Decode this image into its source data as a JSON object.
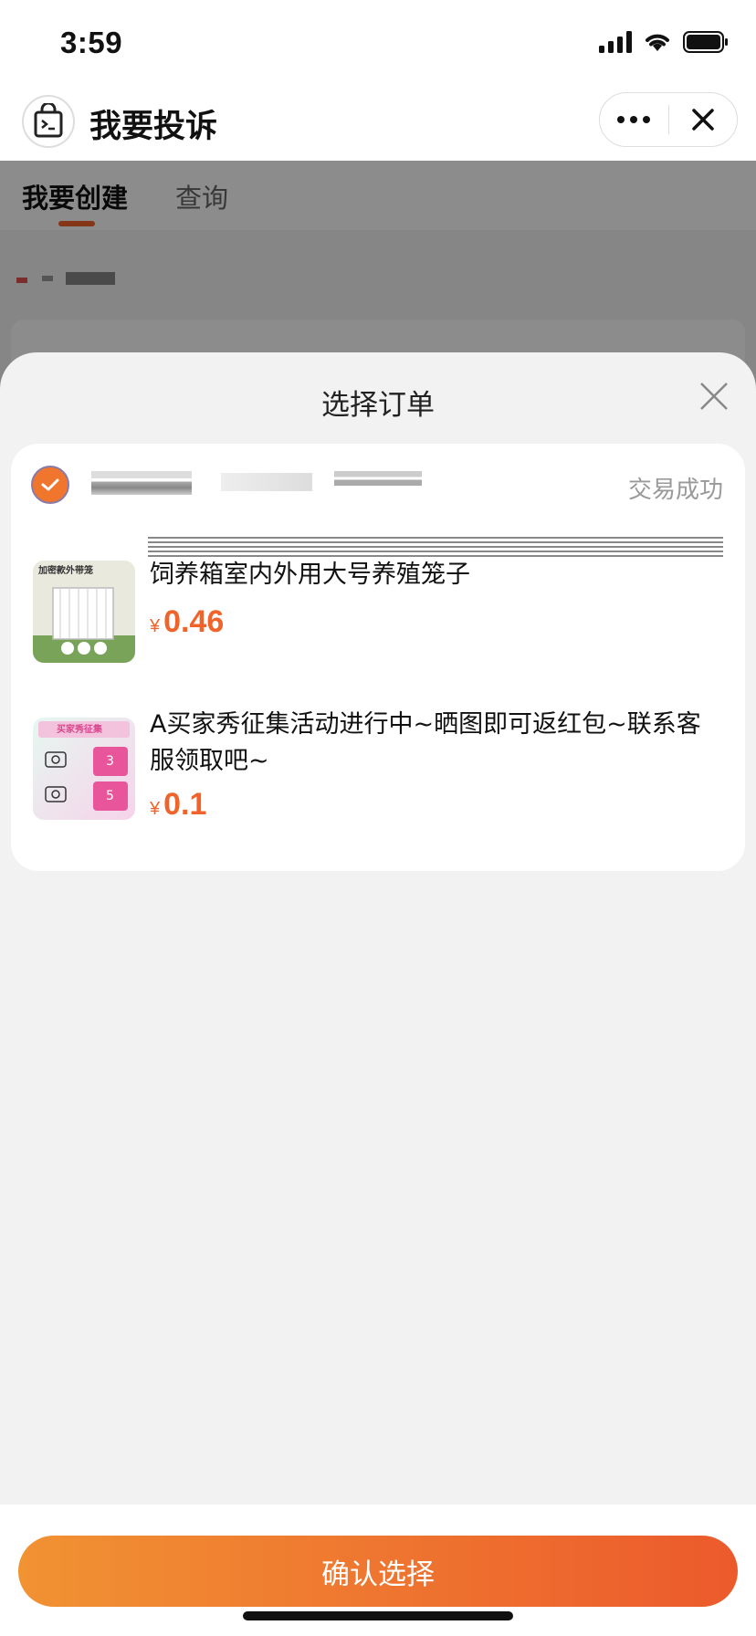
{
  "status_bar": {
    "time": "3:59",
    "icons": [
      "cellular-signal-icon",
      "wifi-icon",
      "battery-icon"
    ]
  },
  "nav": {
    "title": "我要投诉",
    "icons": [
      "app-bag-icon",
      "more-dots-icon",
      "close-icon"
    ]
  },
  "tabs": [
    {
      "label": "我要创建",
      "active": true
    },
    {
      "label": "查询",
      "active": false
    }
  ],
  "sheet": {
    "title": "选择订单",
    "close_icon": "close-icon",
    "order": {
      "selected": true,
      "status": "交易成功",
      "items": [
        {
          "title": "饲养箱室内外用大号养殖笼子",
          "currency": "¥",
          "price": "0.46",
          "thumb_text": "加密款外带笼"
        },
        {
          "title": "A买家秀征集活动进行中~晒图即可返红包~联系客服领取吧~",
          "currency": "¥",
          "price": "0.1",
          "thumb_text": "买家秀征集",
          "thumb_badges": [
            "3",
            "5"
          ]
        }
      ]
    }
  },
  "actions": {
    "confirm_label": "确认选择"
  },
  "colors": {
    "accent": "#f0632a",
    "gradient_start": "#f19233",
    "gradient_end": "#ec5a2c",
    "sheet_bg": "#f2f2f2"
  }
}
